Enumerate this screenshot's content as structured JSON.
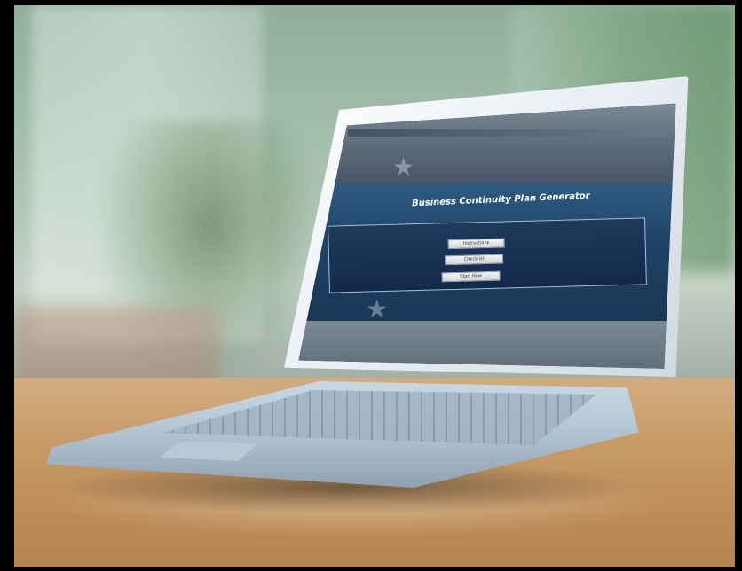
{
  "screen": {
    "title": "Business Continuity Plan Generator",
    "buttons": [
      {
        "label": "Instructions"
      },
      {
        "label": "Checklist"
      },
      {
        "label": "Start Now"
      }
    ]
  },
  "colors": {
    "screen_panel": "#1e3a5d",
    "laptop_body": "#c8d8e4",
    "table": "#c79a66"
  }
}
